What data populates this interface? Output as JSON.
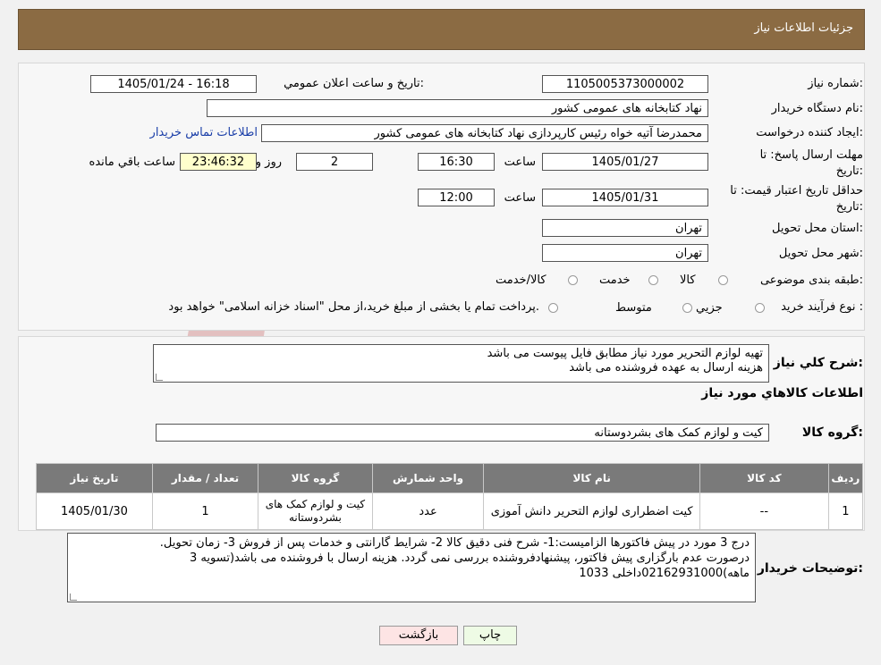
{
  "header": {
    "title": "جزئیات اطلاعات نیاز"
  },
  "watermark": {
    "text": "AriaTender.neT"
  },
  "form": {
    "need_number": {
      "label": "شماره نیاز:",
      "value": "1105005373000002"
    },
    "announce_datetime": {
      "label": "تاریخ و ساعت اعلان عمومي:",
      "value": "1405/01/24 - 16:18"
    },
    "buyer_org": {
      "label": "نام دستگاه خريدار:",
      "value": "نهاد کتابخانه های عمومی کشور"
    },
    "requester": {
      "label": "ايجاد کننده درخواست:",
      "value": "محمدرضا آتیه خواه  رئیس کارپردازی نهاد کتابخانه های عمومی کشور",
      "contact_link": "اطلاعات تماس خريدار"
    },
    "response_deadline": {
      "label": "مهلت ارسال پاسخ: تا تاريخ:",
      "date": "1405/01/27",
      "time_label": "ساعت",
      "time": "16:30",
      "days": "2",
      "days_label": "روز و",
      "remaining": "23:46:32",
      "remaining_label": "ساعت باقي مانده"
    },
    "price_validity": {
      "label": "حداقل تاريخ اعتبار قيمت: تا تاريخ:",
      "date": "1405/01/31",
      "time_label": "ساعت",
      "time": "12:00"
    },
    "delivery_province": {
      "label": "استان محل تحويل:",
      "value": "تهران"
    },
    "delivery_city": {
      "label": "شهر محل تحويل:",
      "value": "تهران"
    },
    "category": {
      "label": "طبقه بندی موضوعی:",
      "options": [
        "کالا",
        "خدمت",
        "کالا/خدمت"
      ]
    },
    "purchase_type": {
      "label": "نوع فرآيند خريد :",
      "options": [
        "جزيي",
        "متوسط"
      ],
      "note": "پرداخت تمام يا بخشی از مبلغ خريد،از محل \"اسناد خزانه اسلامی\" خواهد بود."
    }
  },
  "summary": {
    "label": "شرح کلي نياز:",
    "line1": "تهیه لوازم التحریر مورد نیاز مطابق فایل پیوست می باشد",
    "line2": "هزینه ارسال به عهده فروشنده می باشد"
  },
  "goods": {
    "section_title": "اطلاعات کالاهاي مورد نياز",
    "group_label": "گروه کالا:",
    "group_value": "کیت و لوازم کمک های بشردوستانه",
    "columns": [
      "رديف",
      "کد کالا",
      "نام کالا",
      "واحد شمارش",
      "گروه کالا",
      "تعداد / مقدار",
      "تاريخ نياز"
    ],
    "rows": [
      [
        "1",
        "--",
        "کیت اضطراری لوازم التحریر دانش آموزی",
        "عدد",
        "کیت و لوازم کمک های بشردوستانه",
        "1",
        "1405/01/30"
      ]
    ]
  },
  "buyer_notes": {
    "label": "توضيحات خريدار:",
    "line1": "درج 3 مورد در پیش فاکتورها الزامیست:1- شرح فنی دقیق کالا 2- شرایط گارانتی و خدمات پس از فروش 3- زمان تحویل.",
    "line2": "درصورت عدم بارگزاری پیش فاکتور، پیشنهادفروشنده بررسی نمی گردد. هزینه ارسال با فروشنده می باشد(تسویه 3",
    "line3": "ماهه)02162931000داخلی 1033"
  },
  "buttons": {
    "print": "چاپ",
    "back": "بازگشت"
  },
  "colors": {
    "header": "#8b6b43",
    "print_btn": "#eefbe5",
    "back_btn": "#fde4e4",
    "table_header": "#7a7a7a"
  }
}
